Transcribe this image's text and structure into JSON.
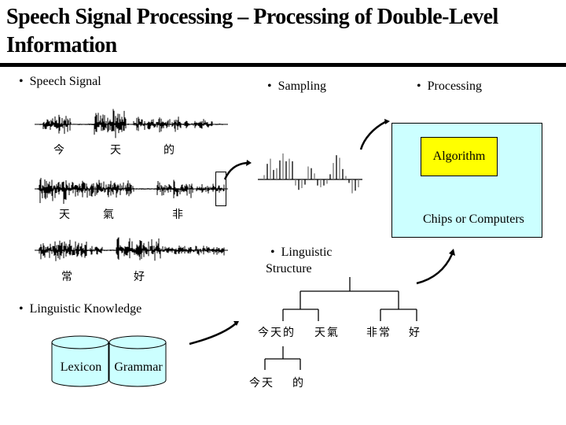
{
  "title": "Speech Signal Processing – Processing of Double-Level Information",
  "title_line1": "Speech Signal Processing – Processing of Double-Level",
  "title_line2": "Information",
  "bullets": {
    "speech_signal": "Speech Signal",
    "sampling": "Sampling",
    "processing": "Processing",
    "linguistic_structure_1": "Linguistic",
    "linguistic_structure_2": "Structure",
    "linguistic_knowledge": "Linguistic Knowledge"
  },
  "bullet_glyph": "•",
  "waveforms": [
    {
      "chars": [
        "今",
        "天",
        "的"
      ]
    },
    {
      "chars": [
        "天",
        "氣",
        "非"
      ]
    },
    {
      "chars": [
        "常",
        "好"
      ]
    }
  ],
  "processing_box": {
    "algorithm_label": "Algorithm",
    "container_label": "Chips or Computers",
    "container_color": "#ccffff",
    "algorithm_color": "#ffff00"
  },
  "knowledge_bases": [
    {
      "label": "Lexicon"
    },
    {
      "label": "Grammar"
    }
  ],
  "tree": {
    "level1": [
      "今天的",
      "天氣",
      "非常",
      "好"
    ],
    "level2": [
      "今天",
      "的"
    ]
  },
  "samples": [
    0.25,
    0.9,
    1.2,
    0.55,
    0.65,
    1.1,
    1.5,
    1.05,
    1.2,
    1.05,
    -0.35,
    -0.6,
    -0.5,
    -0.3,
    0.75,
    0.65,
    0.35,
    -0.35,
    -0.45,
    -0.35,
    -0.25,
    0.3,
    0.95,
    1.4,
    1.25,
    0.6,
    0.2,
    -0.2,
    -0.8,
    -0.65,
    -0.45
  ]
}
